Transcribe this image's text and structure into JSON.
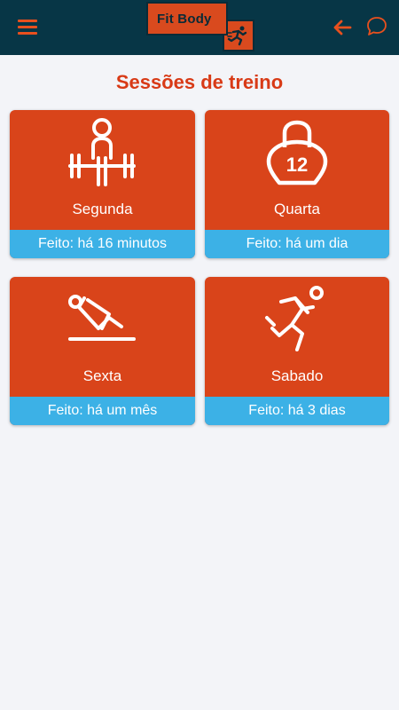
{
  "header": {
    "logo_text": "Fit Body",
    "icons": [
      "menu-icon",
      "back-arrow-icon",
      "chat-icon"
    ],
    "colors": {
      "background": "#073646",
      "accent": "#e8501e"
    }
  },
  "page": {
    "title": "Sessões de treino"
  },
  "sessions": [
    {
      "name": "Segunda",
      "status": "Feito: há 16 minutos",
      "icon": "weightlifter-icon"
    },
    {
      "name": "Quarta",
      "status": "Feito: há um dia",
      "icon": "kettlebell-icon",
      "icon_text": "12"
    },
    {
      "name": "Sexta",
      "status": "Feito: há um mês",
      "icon": "situp-icon"
    },
    {
      "name": "Sabado",
      "status": "Feito: há 3 dias",
      "icon": "runner-icon"
    }
  ],
  "colors": {
    "card": "#d9441a",
    "status_bar": "#3cb1e6",
    "title": "#d83a16"
  }
}
